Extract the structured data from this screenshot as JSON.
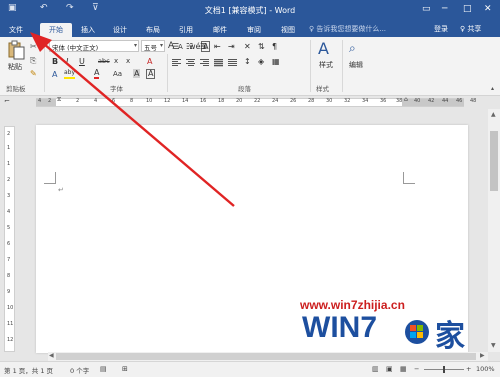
{
  "window": {
    "title": "文档1 [兼容模式] - Word",
    "controls": {
      "restore": "▭",
      "minimize": "─",
      "maximize": "□",
      "close": "✕"
    },
    "quick_access": [
      "save-icon",
      "undo-icon",
      "redo-icon",
      "customize-icon"
    ]
  },
  "tabs": [
    "文件",
    "开始",
    "插入",
    "设计",
    "布局",
    "引用",
    "邮件",
    "审阅",
    "视图"
  ],
  "active_tab": "开始",
  "tell_me": "♀ 告诉我您想要做什么...",
  "account": {
    "sign_in": "登录",
    "share": "♀ 共享"
  },
  "ribbon": {
    "clipboard": {
      "paste_label": "粘贴",
      "group_label": "剪贴板"
    },
    "font": {
      "font_name": "宋体 (中文正文)",
      "font_size": "五号",
      "grow": "A",
      "shrink": "A",
      "aa": "Aa",
      "wen": "wén",
      "wen2": "A",
      "bold": "B",
      "italic": "I",
      "underline": "U",
      "strike": "abc",
      "sub": "x",
      "sup": "x",
      "a_effect": "A",
      "a_highlight": "aby",
      "a_color": "A",
      "aa2": "Aa",
      "char_shade": "A",
      "char_border": "A",
      "group_label": "字体"
    },
    "paragraph": {
      "group_label": "段落"
    },
    "styles": {
      "label": "样式",
      "group_label": "样式"
    },
    "editing": {
      "label": "编辑"
    }
  },
  "ruler": {
    "left_numbers": [
      "4",
      "2"
    ],
    "numbers": [
      "2",
      "4",
      "6",
      "8",
      "10",
      "12",
      "14",
      "16",
      "18",
      "20",
      "22",
      "24",
      "26",
      "28",
      "30",
      "32",
      "34",
      "36",
      "38"
    ],
    "right_numbers": [
      "40",
      "42",
      "44",
      "46",
      "48"
    ]
  },
  "vruler_numbers": [
    "2",
    "1",
    "1",
    "2",
    "3",
    "4",
    "5",
    "6",
    "7",
    "8",
    "9",
    "10",
    "11",
    "12"
  ],
  "document": {
    "paragraph_mark": "↵"
  },
  "status": {
    "page": "第 1 页，共 1 页",
    "words": "0 个字",
    "zoom": "100%"
  },
  "watermark": {
    "url": "www.win7zhijia.cn",
    "logo": "WIN7",
    "family": "家"
  },
  "colors": {
    "accent": "#2b579a",
    "arrow": "#e02424",
    "watermark_red": "#cc1f1f",
    "watermark_blue": "#1d4f9f"
  }
}
